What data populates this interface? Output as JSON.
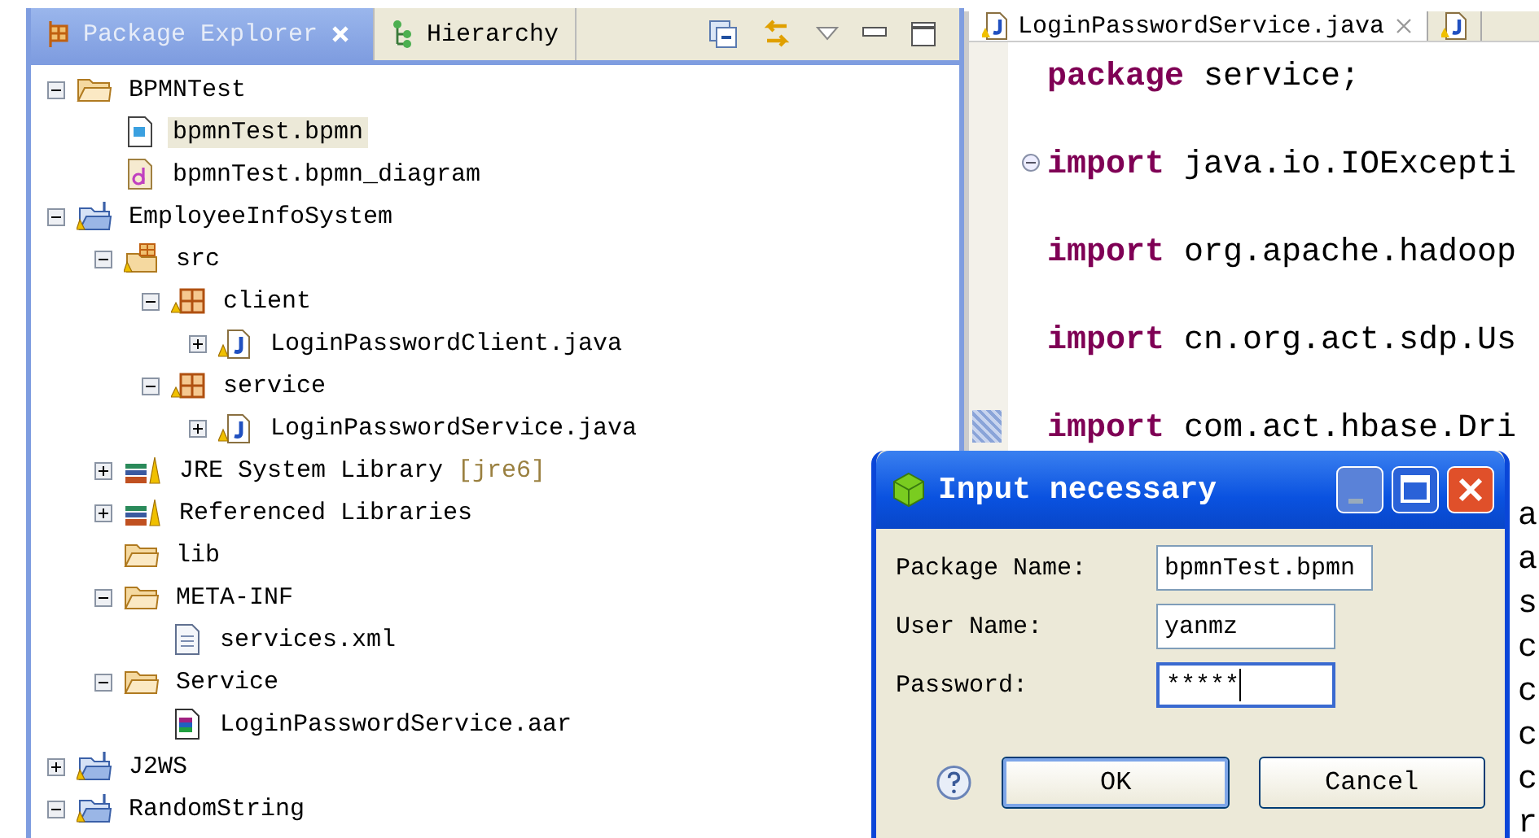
{
  "explorer": {
    "tabs": [
      {
        "label": "Package Explorer",
        "selected": true,
        "kind": "package"
      },
      {
        "label": "Hierarchy",
        "selected": false,
        "kind": "hierarchy"
      }
    ],
    "tree": [
      {
        "label": "BPMNTest",
        "kind": "folder",
        "expanded": true,
        "selected": false,
        "children": [
          {
            "label": "bpmnTest.bpmn",
            "kind": "bpmn",
            "selected": true
          },
          {
            "label": "bpmnTest.bpmn_diagram",
            "kind": "diagram",
            "selected": false
          }
        ]
      },
      {
        "label": "EmployeeInfoSystem",
        "kind": "project",
        "expanded": true,
        "selected": false,
        "children": [
          {
            "label": "src",
            "kind": "srcfolder",
            "expanded": true,
            "selected": false,
            "children": [
              {
                "label": "client",
                "kind": "package",
                "expanded": true,
                "selected": false,
                "children": [
                  {
                    "label": "LoginPasswordClient.java",
                    "kind": "java",
                    "expanded": false,
                    "selected": false
                  }
                ]
              },
              {
                "label": "service",
                "kind": "package",
                "expanded": true,
                "selected": false,
                "children": [
                  {
                    "label": "LoginPasswordService.java",
                    "kind": "java",
                    "expanded": false,
                    "selected": false
                  }
                ]
              }
            ]
          },
          {
            "label": "JRE System Library",
            "decoration": "[jre6]",
            "kind": "library",
            "expanded": false,
            "selected": false
          },
          {
            "label": "Referenced Libraries",
            "kind": "library",
            "expanded": false,
            "selected": false
          },
          {
            "label": "lib",
            "kind": "folder",
            "selected": false
          },
          {
            "label": "META-INF",
            "kind": "folder",
            "expanded": true,
            "selected": false,
            "children": [
              {
                "label": "services.xml",
                "kind": "file",
                "selected": false
              }
            ]
          },
          {
            "label": "Service",
            "kind": "folder",
            "expanded": true,
            "selected": false,
            "children": [
              {
                "label": "LoginPasswordService.aar",
                "kind": "archive",
                "selected": false
              }
            ]
          }
        ]
      },
      {
        "label": "J2WS",
        "kind": "project",
        "expanded": false,
        "selected": false
      },
      {
        "label": "RandomString",
        "kind": "project",
        "expanded": true,
        "selected": false
      }
    ]
  },
  "editor": {
    "tabs": [
      {
        "label": "LoginPasswordService.java",
        "selected": true
      },
      {
        "selected": false
      }
    ],
    "lines": [
      {
        "kind": "code",
        "keyword": "package",
        "rest": " service;",
        "foldable": false
      },
      {
        "kind": "code",
        "keyword": "import",
        "rest": " java.io.IOExcepti",
        "foldable": true
      },
      {
        "kind": "code",
        "keyword": "import",
        "rest": " org.apache.hadoop",
        "foldable": false
      },
      {
        "kind": "code",
        "keyword": "import",
        "rest": " cn.org.act.sdp.Us",
        "foldable": false
      },
      {
        "kind": "code",
        "keyword": "import",
        "rest": " com.act.hbase.Dri",
        "foldable": false
      },
      {
        "kind": "fragment",
        "rest": "a"
      },
      {
        "kind": "fragment",
        "rest": "a"
      },
      {
        "kind": "fragment",
        "rest": "s"
      },
      {
        "kind": "fragment",
        "rest": "c"
      },
      {
        "kind": "fragment",
        "rest": "c"
      },
      {
        "kind": "fragment",
        "rest": "c"
      },
      {
        "kind": "fragment",
        "rest": "c"
      },
      {
        "kind": "fragment",
        "rest": "r"
      }
    ]
  },
  "dialog": {
    "title": "Input necessary",
    "fields": [
      {
        "label": "Package Name:",
        "value": "bpmnTest.bpmn",
        "focused": false
      },
      {
        "label": "User Name:",
        "value": "yanmz",
        "focused": false
      },
      {
        "label": "Password:",
        "value": "*****",
        "focused": true
      }
    ],
    "buttons": [
      {
        "label": "OK",
        "default": true
      },
      {
        "label": "Cancel",
        "default": false
      }
    ]
  }
}
